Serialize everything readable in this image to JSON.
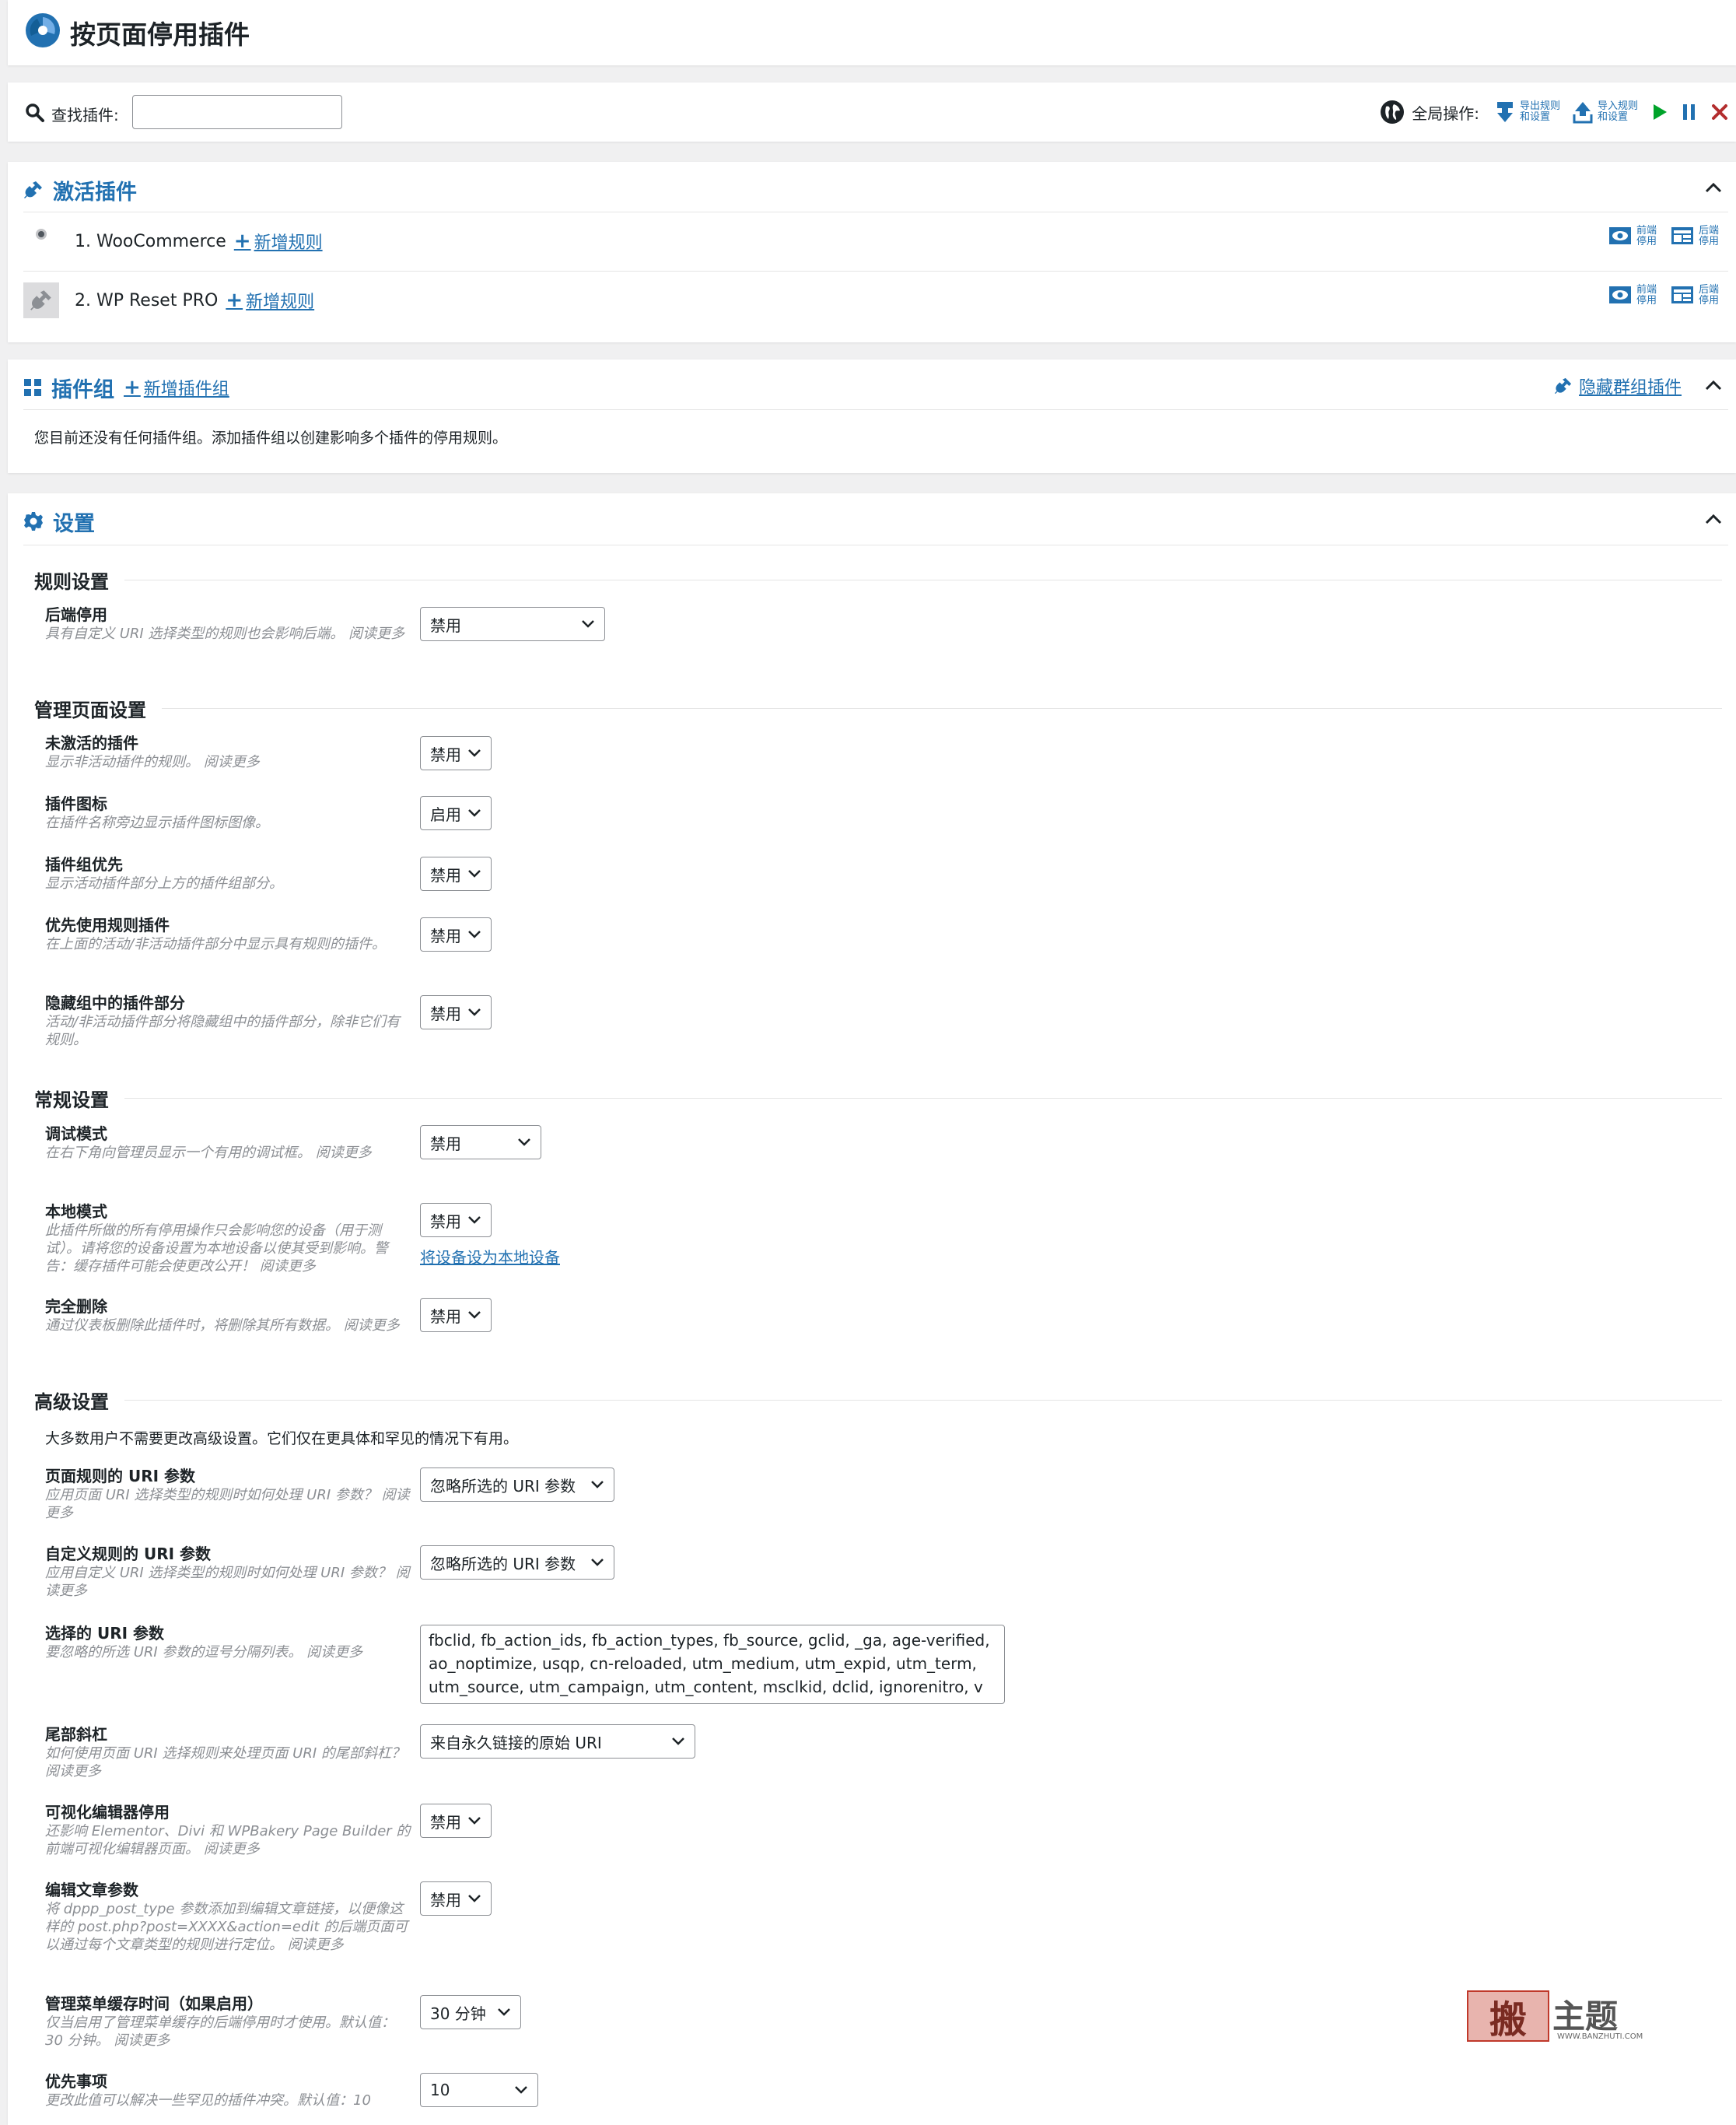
{
  "header": {
    "title": "按页面停用插件"
  },
  "toolbar": {
    "search_label": "查找插件:",
    "search_value": "",
    "global_label": "全局操作:",
    "export_label": "导出规则\n和设置",
    "import_label": "导入规则\n和设置"
  },
  "active": {
    "title": "激活插件",
    "plugins": [
      {
        "name": "1. WooCommerce",
        "add_rule": "新增规则",
        "frontend": "前端\n停用",
        "backend": "后端\n停用"
      },
      {
        "name": "2. WP Reset PRO",
        "add_rule": "新增规则",
        "frontend": "前端\n停用",
        "backend": "后端\n停用"
      }
    ]
  },
  "groups": {
    "title": "插件组",
    "add_group": "新增插件组",
    "hide_link": "隐藏群组插件",
    "empty_text": "您目前还没有任何插件组。添加插件组以创建影响多个插件的停用规则。"
  },
  "settings": {
    "title": "设置",
    "rule_settings": {
      "heading": "规则设置",
      "backend_disable": {
        "name": "后端停用",
        "desc": "具有自定义 URI 选择类型的规则也会影响后端。 阅读更多",
        "value": "禁用"
      }
    },
    "admin_settings": {
      "heading": "管理页面设置",
      "inactive_plugins": {
        "name": "未激活的插件",
        "desc": "显示非活动插件的规则。 阅读更多",
        "value": "禁用"
      },
      "plugin_icons": {
        "name": "插件图标",
        "desc": "在插件名称旁边显示插件图标图像。",
        "value": "启用"
      },
      "groups_first": {
        "name": "插件组优先",
        "desc": "显示活动插件部分上方的插件组部分。",
        "value": "禁用"
      },
      "rules_first": {
        "name": "优先使用规则插件",
        "desc": "在上面的活动/非活动插件部分中显示具有规则的插件。",
        "value": "禁用"
      },
      "hide_group_plugins": {
        "name": "隐藏组中的插件部分",
        "desc": "活动/非活动插件部分将隐藏组中的插件部分，除非它们有规则。",
        "value": "禁用"
      }
    },
    "general_settings": {
      "heading": "常规设置",
      "debug": {
        "name": "调试模式",
        "desc": "在右下角向管理员显示一个有用的调试框。 阅读更多",
        "value": "禁用"
      },
      "local": {
        "name": "本地模式",
        "desc": "此插件所做的所有停用操作只会影响您的设备（用于测试）。请将您的设备设置为本地设备以使其受到影响。警告：缓存插件可能会使更改公开！ 阅读更多",
        "value": "禁用",
        "link": "将设备设为本地设备"
      },
      "full_delete": {
        "name": "完全删除",
        "desc": "通过仪表板删除此插件时，将删除其所有数据。 阅读更多",
        "value": "禁用"
      }
    },
    "advanced_settings": {
      "heading": "高级设置",
      "note": "大多数用户不需要更改高级设置。它们仅在更具体和罕见的情况下有用。",
      "page_uri_params": {
        "name": "页面规则的 URI 参数",
        "desc": "应用页面 URI 选择类型的规则时如何处理 URI 参数？ 阅读更多",
        "value": "忽略所选的 URI 参数"
      },
      "custom_uri_params": {
        "name": "自定义规则的 URI 参数",
        "desc": "应用自定义 URI 选择类型的规则时如何处理 URI 参数？ 阅读更多",
        "value": "忽略所选的 URI 参数"
      },
      "selected_params": {
        "name": "选择的 URI 参数",
        "desc": "要忽略的所选 URI 参数的逗号分隔列表。 阅读更多",
        "value": "fbclid, fb_action_ids, fb_action_types, fb_source, gclid, _ga, age-verified, ao_noptimize, usqp, cn-reloaded, utm_medium, utm_expid, utm_term, utm_source, utm_campaign, utm_content, msclkid, dclid, ignorenitro, v"
      },
      "trailing_slash": {
        "name": "尾部斜杠",
        "desc": "如何使用页面 URI 选择规则来处理页面 URI 的尾部斜杠？ 阅读更多",
        "value": "来自永久链接的原始 URI"
      },
      "visual_editor": {
        "name": "可视化编辑器停用",
        "desc": "还影响 Elementor、Divi 和 WPBakery Page Builder 的前端可视化编辑器页面。 阅读更多",
        "value": "禁用"
      },
      "edit_post_param": {
        "name": "编辑文章参数",
        "desc": "将 dppp_post_type 参数添加到编辑文章链接，以便像这样的 post.php?post=XXXX&action=edit 的后端页面可以通过每个文章类型的规则进行定位。 阅读更多",
        "value": "禁用"
      },
      "menu_cache": {
        "name": "管理菜单缓存时间（如果启用）",
        "desc": "仅当启用了管理菜单缓存的后端停用时才使用。默认值：30 分钟。 阅读更多",
        "value": "30 分钟"
      },
      "priority": {
        "name": "优先事项",
        "desc": "更改此值可以解决一些罕见的插件冲突。默认值：10",
        "value": "10"
      }
    }
  },
  "watermark": {
    "brand": "搬主题",
    "url": "WWW.BANZHUTI.COM"
  }
}
